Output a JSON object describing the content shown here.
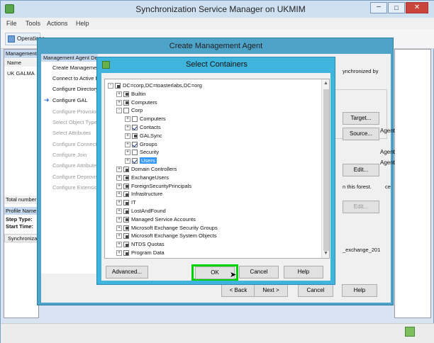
{
  "main_window": {
    "title": "Synchronization Service Manager on UKMIM",
    "menu": [
      "File",
      "Tools",
      "Actions",
      "Help"
    ],
    "toolbar_operations": "Operations",
    "left_pane": {
      "header": "Management Agents",
      "col_name": "Name",
      "row1": "UK GALMA",
      "total": "Total number",
      "profile": "Profile Name",
      "step_type": "Step Type:",
      "start_time": "Start Time:",
      "sync_col": "Synchronization"
    }
  },
  "create_ma": {
    "title": "Create Management Agent",
    "header": "Management Agent Designer",
    "steps": [
      {
        "label": "Create Management Agent",
        "active": false,
        "enabled": true
      },
      {
        "label": "Connect to Active Directory",
        "active": false,
        "enabled": true
      },
      {
        "label": "Configure Directory Partitions",
        "active": false,
        "enabled": true
      },
      {
        "label": "Configure GAL",
        "active": true,
        "enabled": true
      },
      {
        "label": "Configure Provisioning",
        "active": false,
        "enabled": false
      },
      {
        "label": "Select Object Types",
        "active": false,
        "enabled": false
      },
      {
        "label": "Select Attributes",
        "active": false,
        "enabled": false
      },
      {
        "label": "Configure Connector Filter",
        "active": false,
        "enabled": false
      },
      {
        "label": "Configure Join",
        "active": false,
        "enabled": false
      },
      {
        "label": "Configure Attribute Flow",
        "active": false,
        "enabled": false
      },
      {
        "label": "Configure Deprovisioning",
        "active": false,
        "enabled": false
      },
      {
        "label": "Configure Extensions",
        "active": false,
        "enabled": false
      }
    ],
    "right_text_1": "ynchronized by",
    "right_target": "Target...",
    "right_source": "Source...",
    "right_agent1": "Agent",
    "right_agent2": "Agent",
    "right_agent3": "Agent",
    "right_edit1": "Edit...",
    "forest_text": "n this forest.",
    "right_edit2": "Edit...",
    "ce_text": "ce",
    "exchange_text": "_exchange_201",
    "back": "< Back",
    "next": "Next >",
    "cancel": "Cancel",
    "help": "Help"
  },
  "select_containers": {
    "title": "Select Containers",
    "tree": [
      {
        "label": "DC=corp,DC=toasterlabs,DC=org",
        "level": 0,
        "state": "partial",
        "expander": "-"
      },
      {
        "label": "Builtin",
        "level": 1,
        "state": "partial",
        "expander": "+"
      },
      {
        "label": "Computers",
        "level": 1,
        "state": "partial",
        "expander": "+"
      },
      {
        "label": "Corp",
        "level": 1,
        "state": "empty",
        "expander": "-"
      },
      {
        "label": "Computers",
        "level": 2,
        "state": "empty",
        "expander": "+"
      },
      {
        "label": "Contacts",
        "level": 2,
        "state": "checked",
        "expander": "+"
      },
      {
        "label": "GALSync",
        "level": 2,
        "state": "partial",
        "expander": "+"
      },
      {
        "label": "Groups",
        "level": 2,
        "state": "checked",
        "expander": "+"
      },
      {
        "label": "Security",
        "level": 2,
        "state": "empty",
        "expander": "+"
      },
      {
        "label": "Users",
        "level": 2,
        "state": "checked",
        "expander": "+",
        "selected": true
      },
      {
        "label": "Domain Controllers",
        "level": 1,
        "state": "partial",
        "expander": "+"
      },
      {
        "label": "ExchangeUsers",
        "level": 1,
        "state": "partial",
        "expander": "+"
      },
      {
        "label": "ForeignSecurityPrincipals",
        "level": 1,
        "state": "partial",
        "expander": "+"
      },
      {
        "label": "Infrastructure",
        "level": 1,
        "state": "partial",
        "expander": "+"
      },
      {
        "label": "IT",
        "level": 1,
        "state": "partial",
        "expander": "+"
      },
      {
        "label": "LostAndFound",
        "level": 1,
        "state": "partial",
        "expander": "+"
      },
      {
        "label": "Managed Service Accounts",
        "level": 1,
        "state": "partial",
        "expander": "+"
      },
      {
        "label": "Microsoft Exchange Security Groups",
        "level": 1,
        "state": "partial",
        "expander": "+"
      },
      {
        "label": "Microsoft Exchange System Objects",
        "level": 1,
        "state": "partial",
        "expander": "+"
      },
      {
        "label": "NTDS Quotas",
        "level": 1,
        "state": "partial",
        "expander": "+"
      },
      {
        "label": "Program Data",
        "level": 1,
        "state": "partial",
        "expander": "+"
      }
    ],
    "advanced": "Advanced...",
    "ok": "OK",
    "cancel": "Cancel",
    "help": "Help"
  },
  "colors": {
    "titlebar_active": "#3fb4dc",
    "highlight": "#00d400",
    "selection": "#3399ff"
  }
}
